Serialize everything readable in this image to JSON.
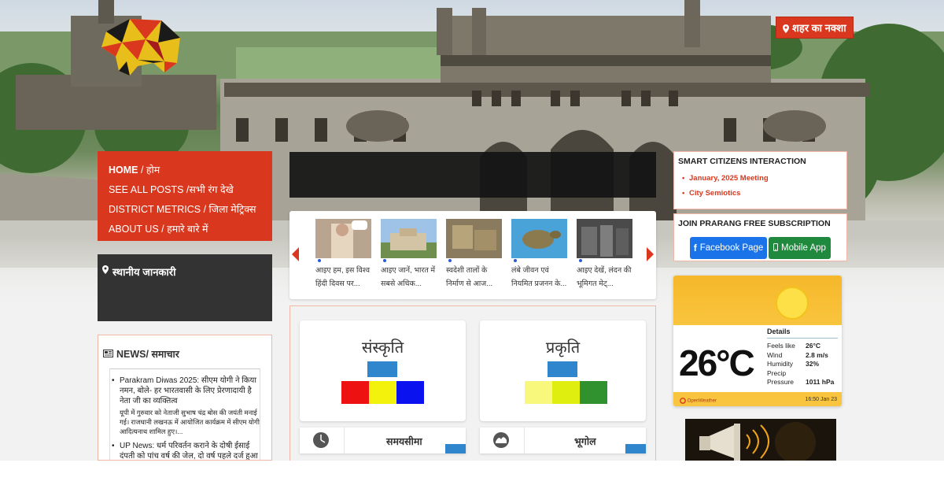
{
  "header": {
    "map_button_label": "शहर का नक्शा"
  },
  "left_nav": {
    "items": [
      {
        "label_en": "HOME",
        "label_hi": " / होम"
      },
      {
        "label_en": "SEE ALL POSTS",
        "label_hi": " /सभी रंग देखे"
      },
      {
        "label_en": "DISTRICT METRICS",
        "label_hi": " / जिला मेट्रिक्स"
      },
      {
        "label_en": "ABOUT US",
        "label_hi": " / हमारे बारे में"
      }
    ]
  },
  "local_info": {
    "label": "स्थानीय जानकारी"
  },
  "news": {
    "heading": "NEWS/ समाचार",
    "items": [
      {
        "headline": "Parakram Diwas 2025: सीएम योगी ने किया नमन, बोले- हर भारतवासी के लिए प्रेरणादायी है नेता जी का व्यक्तित्व",
        "summary": "यूपी में गुरुवार को नेताजी सुभाष चंद्र बोस की जयंती मनाई गई। राजधानी लखनऊ में आयोजित कार्यक्रम में सीएम योगी आदित्यनाथ शामिल हुए।..."
      },
      {
        "headline": "UP News: धर्म परिवर्तन कराने के दोषी ईसाई दंपती को पांच वर्ष की जेल, दो वर्ष पहले दर्ज हुआ था",
        "summary": ""
      }
    ]
  },
  "carousel": {
    "items": [
      {
        "caption_1": "आइए हम, इस विश्व",
        "caption_2": "हिंदी दिवस पर..."
      },
      {
        "caption_1": "आइए जानें, भारत में",
        "caption_2": "सबसे अधिक..."
      },
      {
        "caption_1": "स्वदेशी तालों के",
        "caption_2": "निर्माण से आज..."
      },
      {
        "caption_1": "लंबे जीवन एवं",
        "caption_2": "नियमित प्रजनन के..."
      },
      {
        "caption_1": "आइए देखें, लंदन की",
        "caption_2": "भूमिगत मेट्..."
      }
    ]
  },
  "categories": {
    "culture_title": "संस्कृति",
    "nature_title": "प्रकृति",
    "timeline_label": "समयसीमा",
    "geography_label": "भूगोल"
  },
  "smart_citizens": {
    "heading": "SMART CITIZENS INTERACTION",
    "links": [
      "January, 2025 Meeting",
      "City Semiotics"
    ]
  },
  "subscription": {
    "heading": "JOIN PRARANG FREE SUBSCRIPTION",
    "facebook_label": "Facebook Page",
    "app_label": "Mobile App"
  },
  "weather": {
    "temperature": "26°C",
    "details_title": "Details",
    "rows": [
      {
        "key": "Feels like",
        "value": "26°C"
      },
      {
        "key": "Wind",
        "value": "2.8 m/s"
      },
      {
        "key": "Humidity",
        "value": "32%"
      },
      {
        "key": "Precip",
        "value": ""
      },
      {
        "key": "Pressure",
        "value": "1011 hPa"
      }
    ],
    "provider": "OpenWeather",
    "timestamp": "16:50 Jan 23"
  },
  "colors": {
    "accent": "#d9381e",
    "dark_panel": "#333333",
    "facebook": "#1a73e8",
    "mobile_app": "#1f8a3d"
  }
}
